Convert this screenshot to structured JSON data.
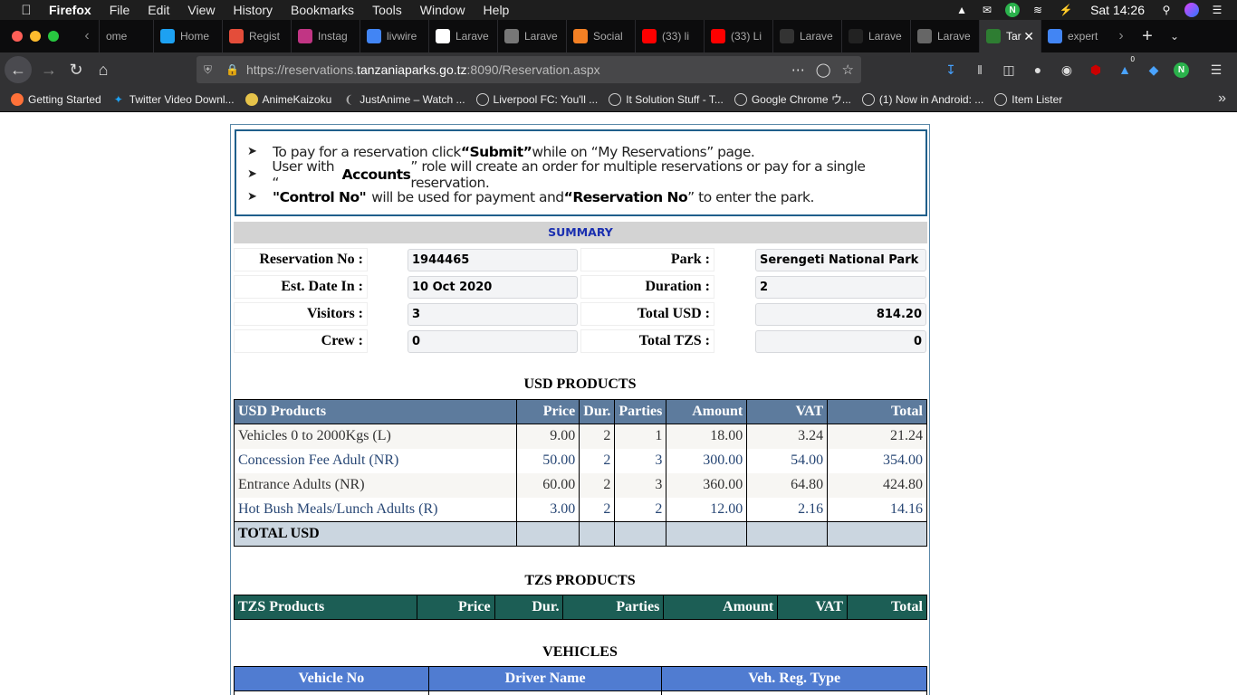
{
  "menubar": {
    "app": "Firefox",
    "items": [
      "File",
      "Edit",
      "View",
      "History",
      "Bookmarks",
      "Tools",
      "Window",
      "Help"
    ],
    "clock": "Sat 14:26"
  },
  "tabs": [
    {
      "label": "ome",
      "color": "#555"
    },
    {
      "label": "Home",
      "color": "#1da1f2"
    },
    {
      "label": "Regist",
      "color": "#e44d3a"
    },
    {
      "label": "Instag",
      "color": "#c13584"
    },
    {
      "label": "livwire",
      "color": "#4285f4"
    },
    {
      "label": "Larave",
      "color": "#ffffff"
    },
    {
      "label": "Larave",
      "color": "#777"
    },
    {
      "label": "Social",
      "color": "#f48024"
    },
    {
      "label": "(33) li",
      "color": "#ff0000"
    },
    {
      "label": "(33) Li",
      "color": "#ff0000"
    },
    {
      "label": "Larave",
      "color": "#333"
    },
    {
      "label": "Larave",
      "color": "#222"
    },
    {
      "label": "Larave",
      "color": "#666"
    },
    {
      "label": "Tar",
      "color": "#2e7d32",
      "active": true
    },
    {
      "label": "expert",
      "color": "#4285f4"
    }
  ],
  "url": {
    "prefix": "https://reservations.",
    "domain": "tanzaniaparks.go.tz",
    "suffix": ":8090/Reservation.aspx"
  },
  "bookmarks": [
    "Getting Started",
    "Twitter Video Downl...",
    "AnimeKaizoku",
    "JustAnime – Watch ...",
    "Liverpool FC: You'll ...",
    "It Solution Stuff - T...",
    "Google Chrome ウ...",
    "(1) Now in Android: ...",
    "Item Lister"
  ],
  "toolbar": {
    "badge": "0"
  },
  "notice": {
    "line1_a": "To pay for a reservation click ",
    "line1_b": "“Submit”",
    "line1_c": " while on “My Reservations” page.",
    "line2_a": "User with “",
    "line2_b": "Accounts",
    "line2_c": "” role will create an order for multiple reservations or pay for a single reservation.",
    "line3_a": "\"Control No\"",
    "line3_b": " will be used for payment and ",
    "line3_c": "“Reservation No",
    "line3_d": "” to enter the park."
  },
  "summary": {
    "title": "SUMMARY",
    "reservation_no_label": "Reservation No :",
    "reservation_no": "1944465",
    "park_label": "Park :",
    "park": "Serengeti National Park",
    "date_in_label": "Est. Date In :",
    "date_in": "10 Oct 2020",
    "duration_label": "Duration :",
    "duration": "2",
    "visitors_label": "Visitors :",
    "visitors": "3",
    "total_usd_label": "Total USD :",
    "total_usd": "814.20",
    "crew_label": "Crew :",
    "crew": "0",
    "total_tzs_label": "Total TZS :",
    "total_tzs": "0"
  },
  "usd": {
    "title": "USD PRODUCTS",
    "headers": [
      "USD Products",
      "Price",
      "Dur.",
      "Parties",
      "Amount",
      "VAT",
      "Total"
    ],
    "rows": [
      [
        "Vehicles 0 to 2000Kgs (L)",
        "9.00",
        "2",
        "1",
        "18.00",
        "3.24",
        "21.24"
      ],
      [
        "Concession Fee Adult (NR)",
        "50.00",
        "2",
        "3",
        "300.00",
        "54.00",
        "354.00"
      ],
      [
        "Entrance Adults (NR)",
        "60.00",
        "2",
        "3",
        "360.00",
        "64.80",
        "424.80"
      ],
      [
        "Hot Bush Meals/Lunch Adults (R)",
        "3.00",
        "2",
        "2",
        "12.00",
        "2.16",
        "14.16"
      ]
    ],
    "total_label": "TOTAL USD"
  },
  "tzs": {
    "title": "TZS PRODUCTS",
    "headers": [
      "TZS Products",
      "Price",
      "Dur.",
      "Parties",
      "Amount",
      "VAT",
      "Total"
    ]
  },
  "vehicles": {
    "title": "VEHICLES",
    "headers": [
      "Vehicle No",
      "Driver Name",
      "Veh. Reg. Type"
    ]
  }
}
